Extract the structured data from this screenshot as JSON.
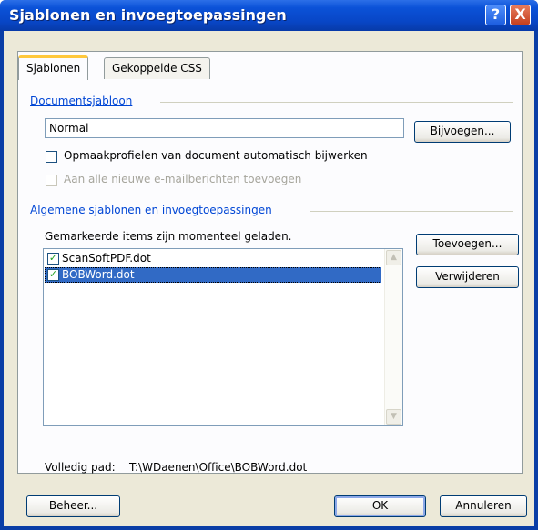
{
  "window": {
    "title": "Sjablonen en invoegtoepassingen",
    "help_label": "?",
    "close_label": "X"
  },
  "tabs": [
    {
      "label": "Sjablonen",
      "active": true
    },
    {
      "label": "Gekoppelde CSS",
      "active": false
    }
  ],
  "document_template": {
    "group_label": "Documentsjabloon",
    "value": "Normal",
    "attach_button": "Bijvoegen...",
    "auto_update_label": "Opmaakprofielen van document automatisch bijwerken",
    "auto_update_checked": false,
    "email_label": "Aan alle nieuwe e-mailberichten toevoegen",
    "email_checked": false,
    "email_enabled": false
  },
  "global_templates": {
    "group_label": "Algemene sjablonen en invoegtoepassingen",
    "hint": "Gemarkeerde items zijn momenteel geladen.",
    "items": [
      {
        "name": "ScanSoftPDF.dot",
        "checked": true,
        "selected": false
      },
      {
        "name": "BOBWord.dot",
        "checked": true,
        "selected": true
      }
    ],
    "add_button": "Toevoegen...",
    "remove_button": "Verwijderen"
  },
  "full_path": {
    "label": "Volledig pad:",
    "value": "T:\\WDaenen\\Office\\BOBWord.dot"
  },
  "footer": {
    "manage_button": "Beheer...",
    "ok_button": "OK",
    "cancel_button": "Annuleren"
  },
  "colors": {
    "titlebar": "#0b52d8",
    "group_label": "#0046d5",
    "selection": "#316ac5",
    "dialog_bg": "#ece9d8"
  }
}
